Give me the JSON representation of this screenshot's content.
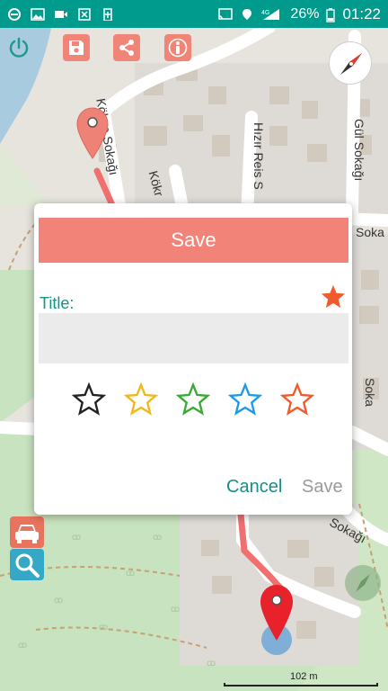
{
  "status_bar": {
    "battery": "26%",
    "time": "01:22",
    "signal_label": "4G"
  },
  "map": {
    "street_labels": [
      "Kökçe Sokağı",
      "Kökr",
      "Hızır Reis S",
      "Gül Sokağı",
      "Soka",
      "Soka",
      "Sokağı"
    ],
    "scale_label": "102 m"
  },
  "toolbar": {
    "icons": [
      "power-icon",
      "save-icon",
      "share-icon",
      "person-icon",
      "compass-icon"
    ]
  },
  "side": {
    "icons": [
      "car-icon",
      "search-icon"
    ]
  },
  "dialog": {
    "header": "Save",
    "title_label": "Title:",
    "title_value": "",
    "fav_star_color": "#f05a2d",
    "star_colors": [
      "#222222",
      "#f2b81b",
      "#3aaa35",
      "#1e9ae8",
      "#f05a2d"
    ],
    "cancel_label": "Cancel",
    "save_label": "Save"
  }
}
